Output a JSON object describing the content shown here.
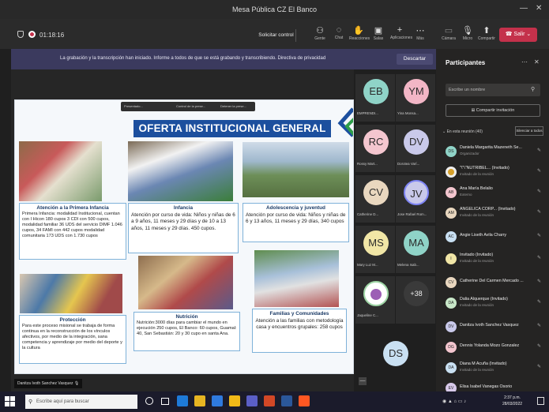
{
  "window": {
    "title": "Mesa Pública CZ El Banco",
    "min": "—",
    "close": "✕"
  },
  "toolbar": {
    "timer": "01:18:16",
    "request_control": "Solicitar control",
    "items": [
      "Gente",
      "Chat",
      "Reacciones",
      "Salas",
      "Aplicaciones",
      "Más"
    ],
    "right_items": [
      "Cámara",
      "Micro",
      "Compartir"
    ],
    "leave": "Salir"
  },
  "banner": {
    "text": "La grabación y la transcripción han iniciado.  Informe a todos de que se está grabando y transcribiendo.  Directiva de privacidad",
    "dismiss": "Descartar"
  },
  "slide": {
    "toolbar": [
      "Presentado...",
      "Control de la prese...",
      "Detener la prese..."
    ],
    "title": "OFERTA INSTITUCIONAL GENERAL",
    "boxes": {
      "primera": {
        "title": "Atención a la Primera Infancia",
        "text": "Primera Infancia: modalidad Institucional, cuentan con I Hicon 180 cupos 3 CDI con 500 cupos, modalidad familiar 36 UDS del servicio DIMF 1.046 cupos, 34 FAMI con 442 cupos modalidad comunitaria 173 UDS con 1.730 cupos"
      },
      "infancia": {
        "title": "Infancia",
        "text": "Atención por curso de vida: Niños y niñas de 6 a 9 años, 11 meses y 29 días y de 10 a 13 años, 11 meses y 29 días. 450 cupos."
      },
      "adolescencia": {
        "title": "Adolescencia y juventud",
        "text": "Atención por curso de vida: Niños y niñas de 6 y 13 años, 11 meses y 29 días, 340 cupos"
      },
      "proteccion": {
        "title": "Protección",
        "text": "Para este proceso misional se trabaja de forma continua en la reconstrucción de los vínculos afectivos, por medio de la integración, sana competencia y aprendizaje por medio del deporte y la cultura"
      },
      "nutricion": {
        "title": "Nutrición",
        "text": "Nutrición:3000 días para cambiar el mundo en ejecución 250 cupos, El Banco: 60 cupos, Guamal: 40, San Sebastián: 20 y 30 cupo en santa Ana."
      },
      "familias": {
        "title": "Familias y Comunidades",
        "text": "Atención a las familias con metodología casa y encuentros grupales: 258 cupos"
      }
    }
  },
  "presenter": "Danitza Ivoth Sanchez Vasquez",
  "tiles": [
    {
      "initials": "EB",
      "name": "EMPRENDI...",
      "color": "#8fd3c7"
    },
    {
      "initials": "YM",
      "name": "Yina Monsa...",
      "color": "#f2b6c6"
    },
    {
      "initials": "RC",
      "name": "Rossy Mart...",
      "color": "#f4c6cf"
    },
    {
      "initials": "DV",
      "name": "Dorotea Varí...",
      "color": "#c9c9ea"
    },
    {
      "initials": "CV",
      "name": "Catherine D...",
      "color": "#e9d7bf"
    },
    {
      "initials": "JV",
      "name": "Jose Rafael Rom...",
      "color": "#c9c9ea"
    },
    {
      "initials": "MS",
      "name": "Mary Luz M...",
      "color": "#f1e6a6"
    },
    {
      "initials": "MA",
      "name": "Melena Isab...",
      "color": "#8fd3c7"
    },
    {
      "initials": "",
      "name": "Jaqueline C...",
      "color": "#9fd6a6"
    },
    {
      "initials": "+38",
      "name": "",
      "color": "#3a3a3a"
    }
  ],
  "self_tile": {
    "initials": "DS"
  },
  "participants": {
    "title": "Participantes",
    "search": "Escribe un nombre",
    "share": "Compartir invitación",
    "section": "En esta reunión (40)",
    "mute_all": "Silenciar a todos",
    "list": [
      {
        "initials": "DS",
        "name": "Daniela Margarita Mazeneth Se...",
        "role": "Organizador",
        "color": "#8fd3c7"
      },
      {
        "initials": "",
        "name": "\"\\\"\\\"NUTRIBEL... (Invitado)",
        "role": "Invitado de la reunión",
        "color": "#eee"
      },
      {
        "initials": "AB",
        "name": "Ana María Belalio",
        "role": "Externo",
        "color": "#f4c6cf"
      },
      {
        "initials": "AM",
        "name": "ANGELICA CORP... (Invitado)",
        "role": "Invitado de la reunión",
        "color": "#e9d7bf"
      },
      {
        "initials": "AC",
        "name": "Angie Liseth Avila Charry",
        "role": "",
        "color": "#c9e0f2"
      },
      {
        "initials": "I",
        "name": "Invitado (Invitado)",
        "role": "Invitado de la reunión",
        "color": "#f1e6a6"
      },
      {
        "initials": "CV",
        "name": "Catherine Del Carmen Mercado ...",
        "role": "",
        "color": "#e9d7bf"
      },
      {
        "initials": "DA",
        "name": "Dalia Alquerque (Invitado)",
        "role": "Invitado de la reunión",
        "color": "#c9e8c9"
      },
      {
        "initials": "DV",
        "name": "Danitza Ivoth Sanchez Vasquez",
        "role": "",
        "color": "#c9c9ea"
      },
      {
        "initials": "DG",
        "name": "Dennis Yolanda Mozo Gonzalez",
        "role": "",
        "color": "#f4c6cf"
      },
      {
        "initials": "DA",
        "name": "Diana M Acuña (Invitado)",
        "role": "Invitado de la reunión",
        "color": "#c9e0f2"
      },
      {
        "initials": "EV",
        "name": "Elisa Isabel Vanegas Osorio",
        "role": "",
        "color": "#d8c9ea"
      }
    ]
  },
  "taskbar": {
    "search": "Escribe aquí para buscar",
    "time": "2:37 p.m.",
    "date": "28/03/2022"
  }
}
